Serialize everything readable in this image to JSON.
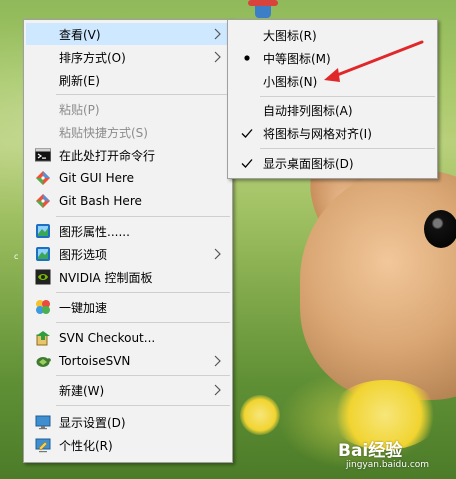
{
  "desktop": {
    "background_colors": {
      "grass": "#8fb95a",
      "rabbit": "#d9a673"
    },
    "icon_label": "c"
  },
  "context_menu": {
    "items": [
      {
        "label": "查看(V)",
        "disabled": false,
        "icon": null,
        "submenu": true
      },
      {
        "label": "排序方式(O)",
        "disabled": false,
        "icon": null,
        "submenu": true
      },
      {
        "label": "刷新(E)",
        "disabled": false,
        "icon": null,
        "submenu": false
      },
      {
        "label": "粘贴(P)",
        "disabled": true,
        "icon": null,
        "submenu": false
      },
      {
        "label": "粘贴快捷方式(S)",
        "disabled": true,
        "icon": null,
        "submenu": false
      },
      {
        "label": "在此处打开命令行",
        "disabled": false,
        "icon": "cmd-icon",
        "submenu": false
      },
      {
        "label": "Git GUI Here",
        "disabled": false,
        "icon": "git-gui-icon",
        "submenu": false
      },
      {
        "label": "Git Bash Here",
        "disabled": false,
        "icon": "git-bash-icon",
        "submenu": false
      },
      {
        "label": "图形属性......",
        "disabled": false,
        "icon": "intel-graphics-icon",
        "submenu": false
      },
      {
        "label": "图形选项",
        "disabled": false,
        "icon": "intel-graphics-icon",
        "submenu": true
      },
      {
        "label": "NVIDIA 控制面板",
        "disabled": false,
        "icon": "nvidia-icon",
        "submenu": false
      },
      {
        "label": "一键加速",
        "disabled": false,
        "icon": "accelerate-icon",
        "submenu": false
      },
      {
        "label": "SVN Checkout...",
        "disabled": false,
        "icon": "svn-checkout-icon",
        "submenu": false
      },
      {
        "label": "TortoiseSVN",
        "disabled": false,
        "icon": "tortoisesvn-icon",
        "submenu": true
      },
      {
        "label": "新建(W)",
        "disabled": false,
        "icon": null,
        "submenu": true
      },
      {
        "label": "显示设置(D)",
        "disabled": false,
        "icon": "display-settings-icon",
        "submenu": false
      },
      {
        "label": "个性化(R)",
        "disabled": false,
        "icon": "personalize-icon",
        "submenu": false
      }
    ]
  },
  "view_submenu": {
    "items": [
      {
        "label": "大图标(R)",
        "mark": null
      },
      {
        "label": "中等图标(M)",
        "mark": "bullet"
      },
      {
        "label": "小图标(N)",
        "mark": null
      },
      {
        "label": "自动排列图标(A)",
        "mark": null
      },
      {
        "label": "将图标与网格对齐(I)",
        "mark": "check"
      },
      {
        "label": "显示桌面图标(D)",
        "mark": "check"
      }
    ]
  },
  "annotation": {
    "pointer_color": "#e0282a"
  },
  "watermark": {
    "name": "Bai经验",
    "url": "jingyan.baidu.com"
  }
}
